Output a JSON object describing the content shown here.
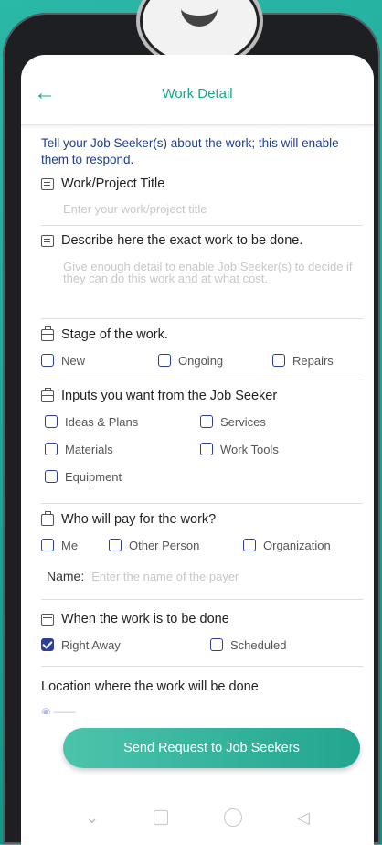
{
  "header": {
    "title": "Work Detail",
    "back_icon": "arrow-left-icon"
  },
  "intro": "Tell your Job Seeker(s) about the work; this will enable them to respond.",
  "title_section": {
    "label": "Work/Project Title",
    "placeholder": "Enter your work/project title"
  },
  "describe_section": {
    "label": "Describe here the exact work to be done.",
    "placeholder": "Give enough detail to enable Job Seeker(s) to decide if they can do this work and at what cost."
  },
  "stage_section": {
    "label": "Stage of the work.",
    "options": [
      {
        "label": "New",
        "checked": false
      },
      {
        "label": "Ongoing",
        "checked": false
      },
      {
        "label": "Repairs",
        "checked": false
      }
    ]
  },
  "inputs_section": {
    "label": "Inputs you want from the Job Seeker",
    "options": [
      {
        "label": "Ideas & Plans",
        "checked": false
      },
      {
        "label": "Services",
        "checked": false
      },
      {
        "label": "Materials",
        "checked": false
      },
      {
        "label": "Work Tools",
        "checked": false
      },
      {
        "label": "Equipment",
        "checked": false
      }
    ]
  },
  "payer_section": {
    "label": "Who will pay for the work?",
    "options": [
      {
        "label": "Me",
        "checked": false
      },
      {
        "label": "Other Person",
        "checked": false
      },
      {
        "label": "Organization",
        "checked": false
      }
    ],
    "name_label": "Name:",
    "name_placeholder": "Enter the name of the payer"
  },
  "when_section": {
    "label": "When the work is to be done",
    "options": [
      {
        "label": "Right Away",
        "checked": true
      },
      {
        "label": "Scheduled",
        "checked": false
      }
    ]
  },
  "location_section": {
    "label": "Location where the work will be done"
  },
  "send_button": "Send Request to Job Seekers",
  "colors": {
    "accent": "#1aa58f",
    "checkbox": "#2c3e9a",
    "intro_text": "#1f3f8c"
  }
}
